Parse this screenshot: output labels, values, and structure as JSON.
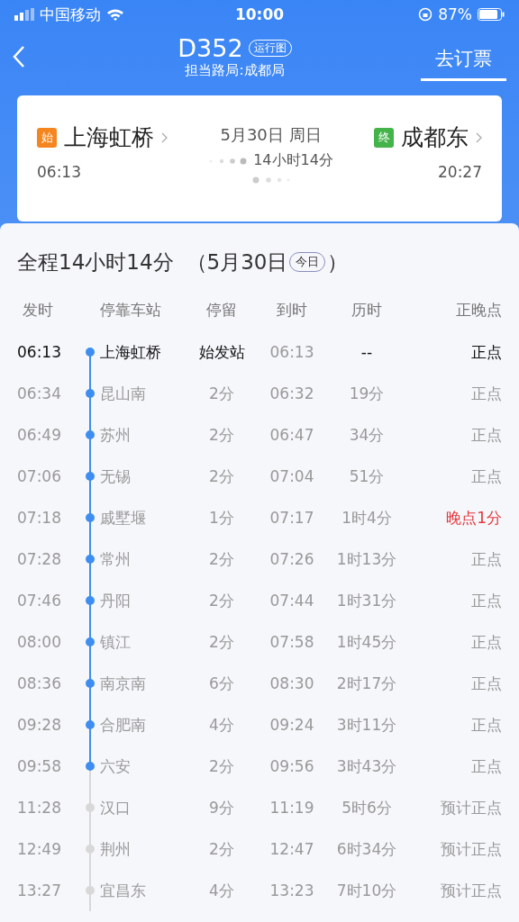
{
  "status_bar": {
    "carrier": "中国移动",
    "time": "10:00",
    "battery": "87%"
  },
  "header": {
    "train": "D352",
    "badge": "运行图",
    "bureau": "担当路局:成都局",
    "action": "去订票"
  },
  "route": {
    "from": {
      "tag": "始",
      "name": "上海虹桥",
      "time": "06:13"
    },
    "date": "5月30日 周日",
    "duration": "14小时14分",
    "to": {
      "tag": "终",
      "name": "成都东",
      "time": "20:27"
    }
  },
  "summary": {
    "total": "全程14小时14分",
    "date_open": "（5月30日",
    "today": "今日",
    "date_close": "）"
  },
  "columns": [
    "发时",
    "停靠车站",
    "停留",
    "到时",
    "历时",
    "正晚点"
  ],
  "rows": [
    {
      "dep": "06:13",
      "station": "上海虹桥",
      "stop": "始发站",
      "arr": "06:13",
      "elapsed": "--",
      "status": "正点",
      "kind": "origin",
      "passed": true,
      "late": false
    },
    {
      "dep": "06:34",
      "station": "昆山南",
      "stop": "2分",
      "arr": "06:32",
      "elapsed": "19分",
      "status": "正点",
      "kind": "stop",
      "passed": true,
      "late": false
    },
    {
      "dep": "06:49",
      "station": "苏州",
      "stop": "2分",
      "arr": "06:47",
      "elapsed": "34分",
      "status": "正点",
      "kind": "stop",
      "passed": true,
      "late": false
    },
    {
      "dep": "07:06",
      "station": "无锡",
      "stop": "2分",
      "arr": "07:04",
      "elapsed": "51分",
      "status": "正点",
      "kind": "stop",
      "passed": true,
      "late": false
    },
    {
      "dep": "07:18",
      "station": "戚墅堰",
      "stop": "1分",
      "arr": "07:17",
      "elapsed": "1时4分",
      "status": "晚点1分",
      "kind": "stop",
      "passed": true,
      "late": true
    },
    {
      "dep": "07:28",
      "station": "常州",
      "stop": "2分",
      "arr": "07:26",
      "elapsed": "1时13分",
      "status": "正点",
      "kind": "stop",
      "passed": true,
      "late": false
    },
    {
      "dep": "07:46",
      "station": "丹阳",
      "stop": "2分",
      "arr": "07:44",
      "elapsed": "1时31分",
      "status": "正点",
      "kind": "stop",
      "passed": true,
      "late": false
    },
    {
      "dep": "08:00",
      "station": "镇江",
      "stop": "2分",
      "arr": "07:58",
      "elapsed": "1时45分",
      "status": "正点",
      "kind": "stop",
      "passed": true,
      "late": false
    },
    {
      "dep": "08:36",
      "station": "南京南",
      "stop": "6分",
      "arr": "08:30",
      "elapsed": "2时17分",
      "status": "正点",
      "kind": "stop",
      "passed": true,
      "late": false
    },
    {
      "dep": "09:28",
      "station": "合肥南",
      "stop": "4分",
      "arr": "09:24",
      "elapsed": "3时11分",
      "status": "正点",
      "kind": "stop",
      "passed": true,
      "late": false
    },
    {
      "dep": "09:58",
      "station": "六安",
      "stop": "2分",
      "arr": "09:56",
      "elapsed": "3时43分",
      "status": "正点",
      "kind": "stop",
      "passed": true,
      "late": false
    },
    {
      "dep": "11:28",
      "station": "汉口",
      "stop": "9分",
      "arr": "11:19",
      "elapsed": "5时6分",
      "status": "预计正点",
      "kind": "stop",
      "passed": false,
      "late": false
    },
    {
      "dep": "12:49",
      "station": "荆州",
      "stop": "2分",
      "arr": "12:47",
      "elapsed": "6时34分",
      "status": "预计正点",
      "kind": "stop",
      "passed": false,
      "late": false
    },
    {
      "dep": "13:27",
      "station": "宜昌东",
      "stop": "4分",
      "arr": "13:23",
      "elapsed": "7时10分",
      "status": "预计正点",
      "kind": "stop",
      "passed": false,
      "late": false
    }
  ]
}
